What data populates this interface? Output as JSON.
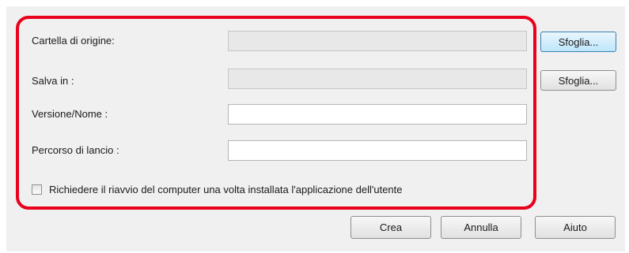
{
  "form": {
    "source_folder_label": "Cartella di origine:",
    "source_folder_value": "",
    "save_in_label": "Salva in :",
    "save_in_value": "",
    "version_name_label": "Versione/Nome :",
    "version_name_value": "",
    "launch_path_label": "Percorso di lancio :",
    "launch_path_value": "",
    "browse_label": "Sfoglia...",
    "restart_checkbox_label": "Richiedere il riavvio del computer una volta installata l'applicazione dell'utente",
    "restart_checked": false
  },
  "footer": {
    "create_label": "Crea",
    "cancel_label": "Annulla",
    "help_label": "Aiuto"
  },
  "colors": {
    "highlight": "#e8001c",
    "dialog_bg": "#f0f0f0",
    "focused_button": "#bee6fd"
  }
}
